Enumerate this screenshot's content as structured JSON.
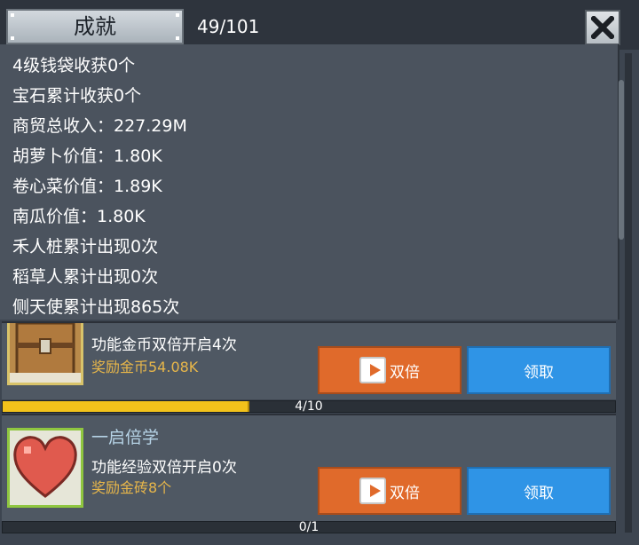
{
  "header": {
    "title": "成就",
    "count": "49/101"
  },
  "stats": [
    "4级钱袋收获0个",
    "宝石累计收获0个",
    "商贸总收入：227.29M",
    "胡萝卜价值：1.80K",
    "卷心菜价值：1.89K",
    "南瓜价值：1.80K",
    "禾人桩累计出现0次",
    "稻草人累计出现0次",
    "侧天使累计出现865次"
  ],
  "cards": [
    {
      "icon": "treasure-chest-icon",
      "subtitle": "功能金币双倍开启4次",
      "reward": "奖励金币54.08K",
      "double_label": "双倍",
      "claim_label": "领取",
      "progress_text": "4/10",
      "progress_value": 0.4
    },
    {
      "icon": "heart-icon",
      "name": "一启倍学",
      "subtitle": "功能经验双倍开启0次",
      "reward": "奖励金砖8个",
      "double_label": "双倍",
      "claim_label": "领取",
      "progress_text": "0/1",
      "progress_value": 0
    }
  ],
  "colors": {
    "background": "#3d4550",
    "double_button": "#e06a2b",
    "claim_button": "#2f94e6",
    "progress_fill": "#f2c21b",
    "reward_text": "#e7b64a"
  }
}
